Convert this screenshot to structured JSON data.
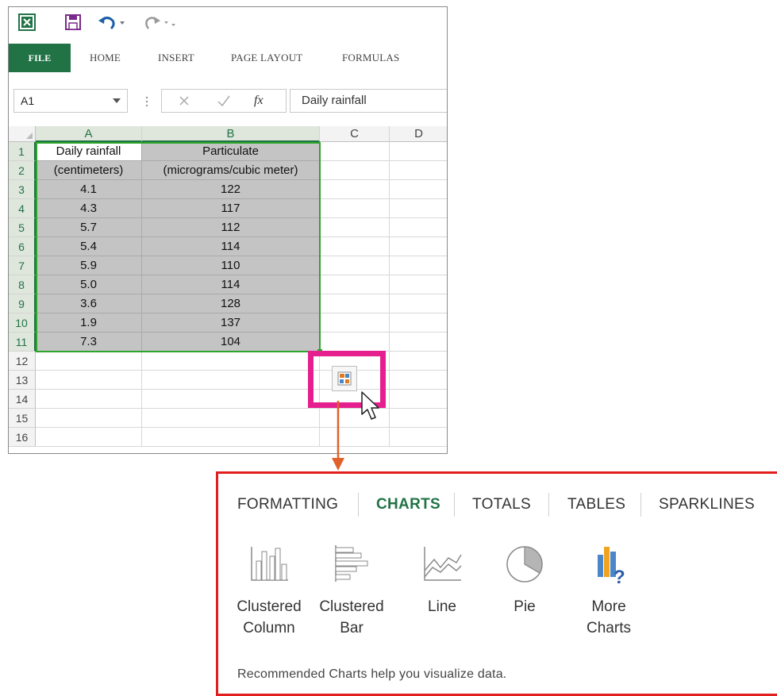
{
  "excel": {
    "ribbon_tabs": [
      "FILE",
      "HOME",
      "INSERT",
      "PAGE LAYOUT",
      "FORMULAS"
    ],
    "name_box": "A1",
    "formula_value": "Daily rainfall",
    "fx_label": "fx",
    "columns": [
      "A",
      "B",
      "C",
      "D"
    ],
    "rows": [
      "1",
      "2",
      "3",
      "4",
      "5",
      "6",
      "7",
      "8",
      "9",
      "10",
      "11",
      "12",
      "13",
      "14",
      "15",
      "16"
    ],
    "data": [
      [
        "Daily rainfall",
        "Particulate"
      ],
      [
        "(centimeters)",
        "(micrograms/cubic meter)"
      ],
      [
        "4.1",
        "122"
      ],
      [
        "4.3",
        "117"
      ],
      [
        "5.7",
        "112"
      ],
      [
        "5.4",
        "114"
      ],
      [
        "5.9",
        "110"
      ],
      [
        "5.0",
        "114"
      ],
      [
        "3.6",
        "128"
      ],
      [
        "1.9",
        "137"
      ],
      [
        "7.3",
        "104"
      ]
    ],
    "selection_color": "#2ba52b",
    "highlight_color": "#e61f8f"
  },
  "panel": {
    "tabs": [
      "FORMATTING",
      "CHARTS",
      "TOTALS",
      "TABLES",
      "SPARKLINES"
    ],
    "active_tab": "CHARTS",
    "charts": [
      {
        "label1": "Clustered",
        "label2": "Column",
        "icon": "clustered-column-icon"
      },
      {
        "label1": "Clustered",
        "label2": "Bar",
        "icon": "clustered-bar-icon"
      },
      {
        "label1": "Line",
        "label2": "",
        "icon": "line-chart-icon"
      },
      {
        "label1": "Pie",
        "label2": "",
        "icon": "pie-chart-icon"
      },
      {
        "label1": "More",
        "label2": "Charts",
        "icon": "more-charts-icon"
      }
    ],
    "hint": "Recommended Charts help you visualize data.",
    "accent": "#217346",
    "border_color": "#e11d1d"
  }
}
